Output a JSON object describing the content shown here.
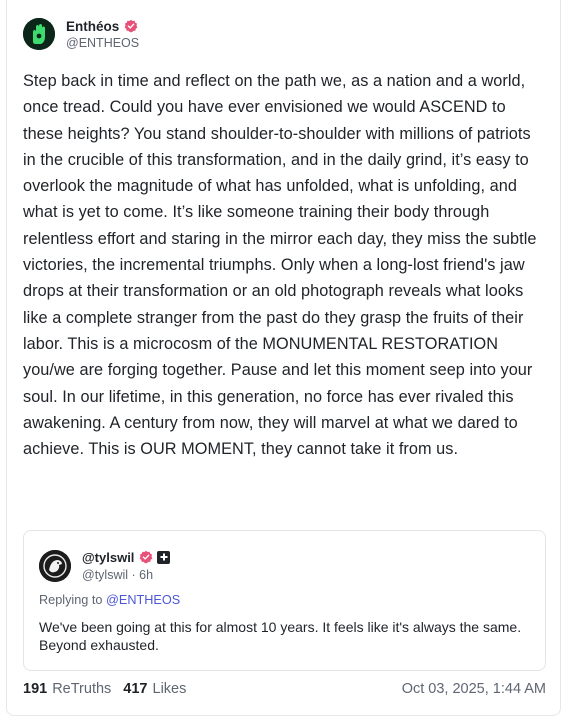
{
  "post": {
    "author": {
      "display_name": "Enthéos",
      "handle": "@ENTHEOS",
      "verified": true,
      "avatar_icon": "green-hand-avatar"
    },
    "body": "Step back in time and reflect on the path we, as a nation and a world, once tread. Could you have ever envisioned we would ASCEND to these heights? You stand shoulder-to-shoulder with millions of patriots in the crucible of this transformation, and in the daily grind, it’s easy to overlook the magnitude of what has unfolded, what is unfolding, and what is yet to come. It’s like someone training their body through relentless effort and staring in the mirror each day, they miss the subtle victories, the incremental triumphs. Only when a long-lost friend's jaw drops at their transformation or an old photograph reveals what looks like a complete stranger from the past do they grasp the fruits of their labor. This is a microcosm of the MONUMENTAL RESTORATION you/we are forging together. Pause and let this moment seep into your soul. In our lifetime, in this generation, no force has ever rivaled this awakening. A century from now, they will marvel at what we dared to achieve. This is OUR MOMENT, they cannot take it from us.",
    "quote": {
      "display_name": "@tylswil",
      "handle": "@tylswil",
      "separator": "·",
      "age": "6h",
      "replying_prefix": "Replying to",
      "replying_to": "@ENTHEOS",
      "body": "We've been going at this for almost 10 years. It feels like it's always the same. Beyond exhausted."
    },
    "stats": {
      "retruths_count": "191",
      "retruths_label": "ReTruths",
      "likes_count": "417",
      "likes_label": "Likes"
    },
    "timestamp": "Oct 03, 2025, 1:44 AM"
  },
  "colors": {
    "verified_badge": "#e8507a",
    "link": "#4c57d6",
    "muted_text": "#5f6672",
    "primary_text": "#1f2328"
  }
}
